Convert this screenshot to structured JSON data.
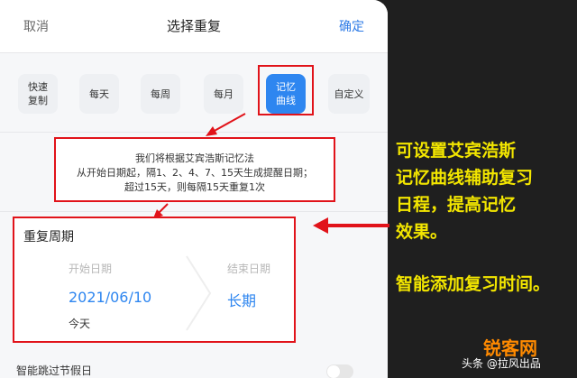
{
  "header": {
    "cancel": "取消",
    "title": "选择重复",
    "confirm": "确定"
  },
  "options": [
    {
      "line1": "快速",
      "line2": "复制",
      "selected": false
    },
    {
      "line1": "每天",
      "line2": "",
      "selected": false
    },
    {
      "line1": "每周",
      "line2": "",
      "selected": false
    },
    {
      "line1": "每月",
      "line2": "",
      "selected": false
    },
    {
      "line1": "记忆",
      "line2": "曲线",
      "selected": true
    },
    {
      "line1": "自定义",
      "line2": "",
      "selected": false
    }
  ],
  "note": {
    "line1": "我们将根据艾宾浩斯记忆法",
    "line2": "从开始日期起，隔1、2、4、7、15天生成提醒日期；",
    "line3": "超过15天，则每隔15天重复1次"
  },
  "period": {
    "title": "重复周期",
    "start_label": "开始日期",
    "start_value": "2021/06/10",
    "start_sub": "今天",
    "end_label": "结束日期",
    "end_value": "长期"
  },
  "skip_holidays": {
    "label": "智能跳过节假日",
    "enabled": false
  },
  "callout": {
    "lines": [
      "可设置艾宾浩斯",
      "记忆曲线辅助复习",
      "日程，提高记忆",
      "效果。"
    ],
    "line_extra": "智能添加复习时间。"
  },
  "watermark": {
    "brand": "锐客网",
    "source": "头条 @拉风出品"
  },
  "colors": {
    "accent": "#2e86f0",
    "highlight": "#e1131a",
    "callout": "#f3e600"
  }
}
